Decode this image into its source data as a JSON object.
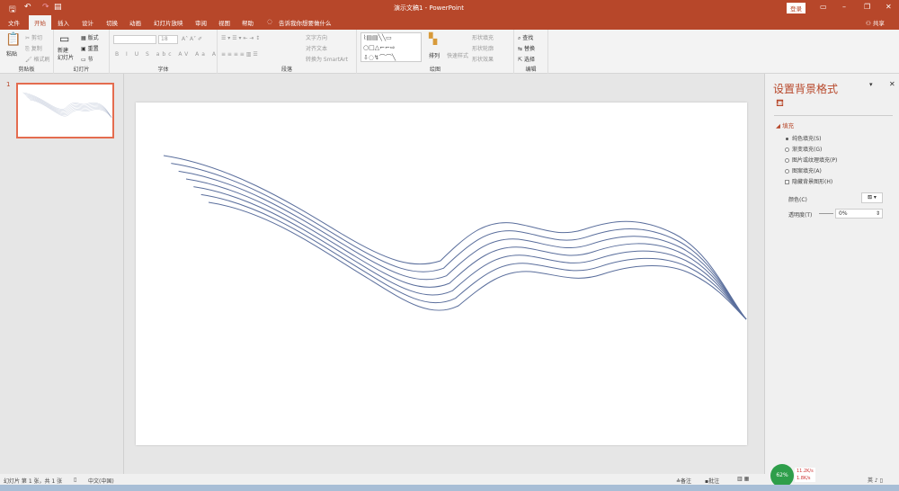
{
  "window": {
    "title": "演示文稿1  -  PowerPoint",
    "login": "登录",
    "share": "共享"
  },
  "tabs": [
    "文件",
    "开始",
    "插入",
    "设计",
    "切换",
    "动画",
    "幻灯片放映",
    "审阅",
    "视图",
    "帮助"
  ],
  "tell_me": "告诉我你想要做什么",
  "ribbon": {
    "clipboard": {
      "label": "剪贴板",
      "paste": "粘贴",
      "cut": "剪切",
      "copy": "复制",
      "format_painter": "格式刷"
    },
    "slides": {
      "label": "幻灯片",
      "new_slide": "新建\n幻灯片",
      "layout": "版式",
      "reset": "重置",
      "section": "节"
    },
    "font": {
      "label": "字体",
      "size": "18"
    },
    "paragraph": {
      "label": "段落",
      "text_direction": "文字方向",
      "align_text": "对齐文本",
      "smartart": "转换为 SmartArt"
    },
    "drawing": {
      "label": "绘图",
      "arrange": "排列",
      "quick_styles": "快速样式",
      "shape_fill": "形状填充",
      "shape_outline": "形状轮廓",
      "shape_effects": "形状效果"
    },
    "editing": {
      "label": "编辑",
      "find": "查找",
      "replace": "替换",
      "select": "选择"
    }
  },
  "thumbnails": [
    {
      "number": "1"
    }
  ],
  "format_pane": {
    "title": "设置背景格式",
    "section": "填充",
    "options": [
      {
        "label": "纯色填充(S)",
        "type": "radio",
        "checked": true
      },
      {
        "label": "渐变填充(G)",
        "type": "radio",
        "checked": false
      },
      {
        "label": "图片或纹理填充(P)",
        "type": "radio",
        "checked": false
      },
      {
        "label": "图案填充(A)",
        "type": "radio",
        "checked": false
      },
      {
        "label": "隐藏背景图形(H)",
        "type": "checkbox",
        "checked": false
      }
    ],
    "color_label": "颜色(C)",
    "transparency_label": "透明度(T)",
    "transparency_value": "0%"
  },
  "status": {
    "slide_info": "幻灯片 第 1 张，共 1 张",
    "language": "中文(中国)",
    "notes": "备注",
    "comments": "批注",
    "net_percent": "62%",
    "up_speed": "11.2K/s",
    "down_speed": "1.8K/s",
    "ime": "英"
  },
  "colors": {
    "accent": "#b7472a",
    "curve": "#5a6e9c"
  }
}
